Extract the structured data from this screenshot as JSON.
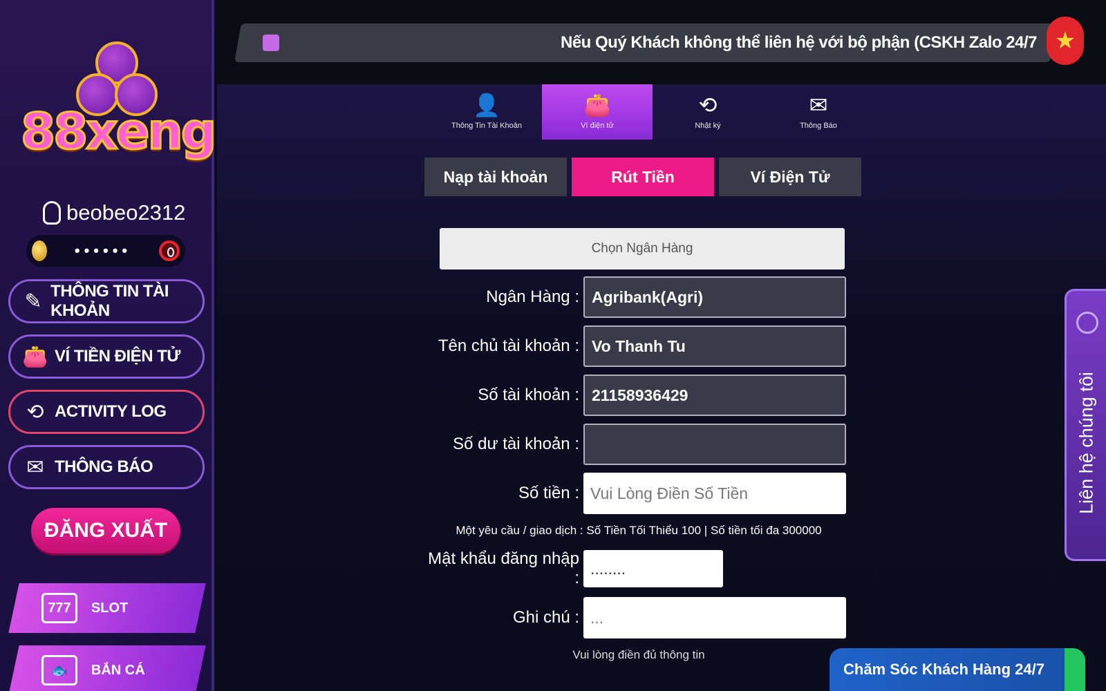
{
  "brand": {
    "logo_text": "88xeng"
  },
  "user": {
    "name": "beobeo2312",
    "balance_masked": "••••••"
  },
  "sidebar": {
    "items": [
      {
        "label": "THÔNG TIN TÀI KHOẢN",
        "icon": "pen-icon"
      },
      {
        "label": "VÍ TIỀN ĐIỆN TỬ",
        "icon": "wallet-icon"
      },
      {
        "label": "ACTIVITY LOG",
        "icon": "history-icon"
      },
      {
        "label": "THÔNG BÁO",
        "icon": "mail-icon"
      }
    ],
    "logout_label": "ĐĂNG XUẤT",
    "games": [
      {
        "label": "SLOT",
        "icon": "slot-777-icon",
        "icon_text": "777"
      },
      {
        "label": "BẮN CÁ",
        "icon": "fish-icon"
      }
    ]
  },
  "marquee": {
    "text": "Nếu Quý Khách không thể liên hệ với bộ phận (CSKH Zalo 24/7"
  },
  "tabs": [
    {
      "label": "Thông Tin Tài Khoản",
      "icon": "user-icon"
    },
    {
      "label": "Ví điện tử",
      "icon": "wallet-icon"
    },
    {
      "label": "Nhật ký",
      "icon": "history-icon"
    },
    {
      "label": "Thông Báo",
      "icon": "mail-icon"
    }
  ],
  "subtabs": [
    "Nạp tài khoản",
    "Rút Tiền",
    "Ví Điện Tử"
  ],
  "form": {
    "bank_select_placeholder": "Chọn Ngân Hàng",
    "bank_label": "Ngân Hàng :",
    "bank_value": "Agribank(Agri)",
    "owner_label": "Tên chủ tài khoản :",
    "owner_value": "Vo Thanh Tu",
    "account_label": "Số tài khoản :",
    "account_value": "21158936429",
    "balance_label": "Số dư tài khoản :",
    "balance_value": "",
    "amount_label": "Số tiền :",
    "amount_placeholder": "Vui Lòng Điền Số Tiền",
    "limit_note": "Một yêu cầu / giao dịch : Số Tiền Tối Thiểu 100 | Số tiền tối đa 300000",
    "password_label": "Mật khẩu đăng nhập :",
    "password_value": "........",
    "note_label": "Ghi chú :",
    "note_placeholder": "...",
    "footnote": "Vui lòng điền đủ thông tin"
  },
  "contact": {
    "label": "Liên hệ chúng tôi"
  },
  "support": {
    "label": "Chăm Sóc Khách Hàng 24/7"
  },
  "colors": {
    "accent_pink": "#ec1b86",
    "accent_purple": "#8a2ad8",
    "flag_red": "#e0262c"
  }
}
